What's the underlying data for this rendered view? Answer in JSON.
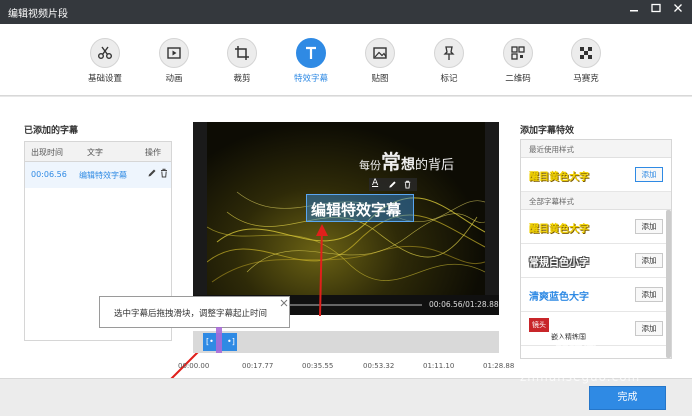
{
  "window": {
    "title": "编辑视频片段",
    "min_icon": "minimize-icon",
    "max_icon": "maximize-icon",
    "close_icon": "close-icon"
  },
  "toolbar": {
    "tools": [
      {
        "label": "基础设置",
        "icon": "scissors-icon"
      },
      {
        "label": "动画",
        "icon": "animation-icon"
      },
      {
        "label": "裁剪",
        "icon": "crop-icon"
      },
      {
        "label": "特效字幕",
        "icon": "text-icon",
        "active": true
      },
      {
        "label": "贴图",
        "icon": "image-icon"
      },
      {
        "label": "标记",
        "icon": "pin-icon"
      },
      {
        "label": "二维码",
        "icon": "qrcode-icon"
      },
      {
        "label": "马赛克",
        "icon": "mosaic-icon"
      }
    ]
  },
  "added_subtitles": {
    "title": "已添加的字幕",
    "columns": [
      "出现时间",
      "文字",
      "操作"
    ],
    "rows": [
      {
        "time": "00:06.56",
        "text": "编辑特效字幕"
      }
    ]
  },
  "preview": {
    "video_text_top": "每份",
    "video_text_top_big": "常",
    "video_text_top_big2": "想",
    "video_text_top_tail": "的背后",
    "subtitle_text": "编辑特效字幕",
    "time": "00:06.56/01:28.88",
    "font_icon_label": "A"
  },
  "tooltip": {
    "text": "选中字幕后拖拽滑块，调整字幕起止时间"
  },
  "timeline": {
    "ticks": [
      "00:00.00",
      "00:17.77",
      "00:35.55",
      "00:53.32",
      "01:11.10",
      "01:28.88"
    ]
  },
  "styles_panel": {
    "title": "添加字幕特效",
    "recent_group": "最近使用样式",
    "all_group": "全部字幕样式",
    "add_label": "添加",
    "recent": [
      {
        "name": "醒目黄色大字",
        "color": "#f2d200"
      }
    ],
    "all": [
      {
        "name": "醒目黄色大字",
        "color": "#f2d200"
      },
      {
        "name": "常規白色小字",
        "color": "#555555"
      },
      {
        "name": "清爽蓝色大字",
        "color": "#2f8ae4"
      }
    ],
    "partial_item_line1": "镜头",
    "partial_item_line2": "嵌入精练国"
  },
  "footer": {
    "done_label": "完成"
  },
  "watermark": {
    "main": "zhinanseguo.com",
    "corner": "品指南"
  },
  "colors": {
    "accent": "#2f8ae4",
    "titlebar": "#34383d",
    "arrow": "#e0201b"
  }
}
